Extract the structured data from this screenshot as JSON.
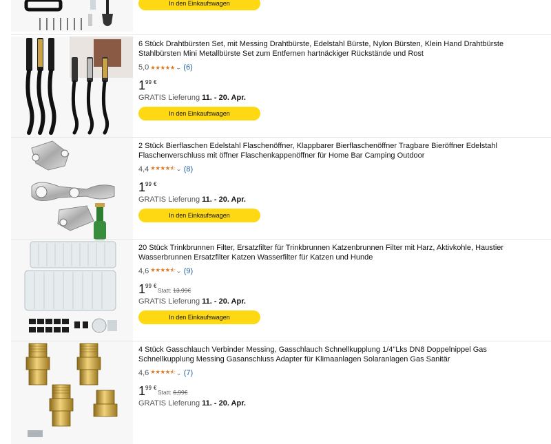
{
  "cart_label": "In den Einkaufswagen",
  "delivery_prefix": "GRATIS Lieferung",
  "statt_label": "Statt:",
  "products": [
    {
      "title": "6 Stück Drahtbürsten Set, mit Messing Drahtbürste, Edelstahl Bürste, Nylon Bürsten, Klein Hand Drahtbürste Stahlbürsten Mini Metallbürste Set zum Entfernen hartnäckiger Rückstände und Rost",
      "rating": "5,0",
      "stars": "★★★★★",
      "reviews": "(6)",
      "price_whole": "1",
      "price_frac": "99",
      "currency": "€",
      "old_price": "",
      "delivery_date": "11. - 20. Apr."
    },
    {
      "title": "2 Stück Bierflaschen Edelstahl Flaschenöffner, Klappbarer Bierflaschenöffner Tragbare Bieröffner Edelstahl Flaschenverschluss mit öffner Flaschenkappenöffner für Home Bar Camping Outdoor",
      "rating": "4,4",
      "stars": "★★★★⯪",
      "reviews": "(8)",
      "price_whole": "1",
      "price_frac": "99",
      "currency": "€",
      "old_price": "",
      "delivery_date": "11. - 20. Apr."
    },
    {
      "title": "20 Stück Trinkbrunnen Filter, Ersatzfilter für Trinkbrunnen Katzenbrunnen Filter mit Harz, Aktivkohle, Haustier Wasserbrunnen Ersatzfilter Katzen Wasserfilter für Katzen und Hunde",
      "rating": "4,6",
      "stars": "★★★★⯪",
      "reviews": "(9)",
      "price_whole": "1",
      "price_frac": "99",
      "currency": "€",
      "old_price": "13,99€",
      "delivery_date": "11. - 20. Apr."
    },
    {
      "title": "4 Stück Gasschlauch Verbinder Messing, Gasschlauch Schnellkupplung 1/4\"Lks DN8 Doppelnippel Gas Schnellkupplung Messing Gasanschluss Adapter für Klimaanlagen Solaranlagen Gas Sanitär",
      "rating": "4,6",
      "stars": "★★★★⯪",
      "reviews": "(7)",
      "price_whole": "1",
      "price_frac": "99",
      "currency": "€",
      "old_price": "6,99€",
      "delivery_date": "11. - 20. Apr."
    }
  ]
}
